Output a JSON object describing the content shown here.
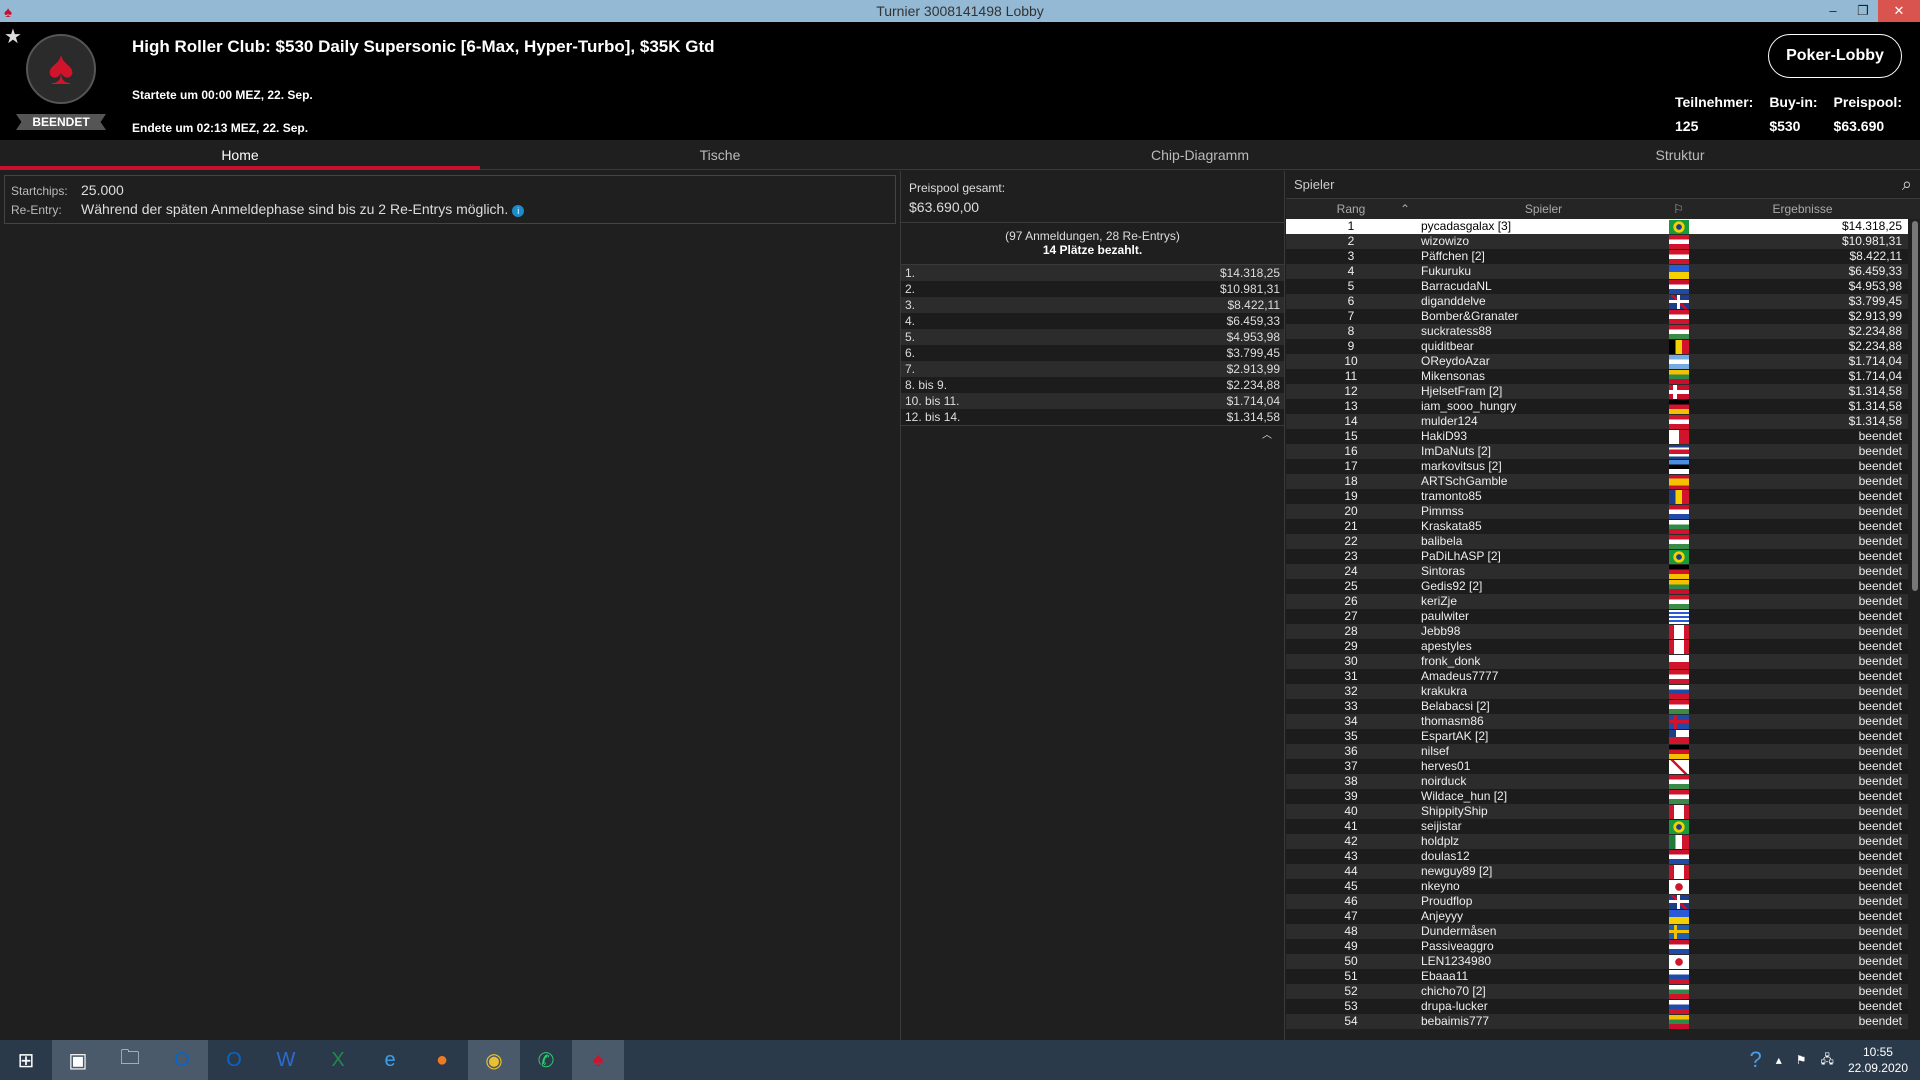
{
  "window": {
    "title": "Turnier 3008141498 Lobby",
    "minimize": "–",
    "restore": "❐",
    "close": "✕"
  },
  "header": {
    "title": "High Roller Club: $530 Daily Supersonic [6-Max, Hyper-Turbo], $35K Gtd",
    "started": "Startete um 00:00 MEZ, 22. Sep.",
    "ended": "Endete um 02:13 MEZ, 22. Sep.",
    "status": "BEENDET",
    "lobby_button": "Poker-Lobby",
    "stats": {
      "participants_label": "Teilnehmer:",
      "participants": "125",
      "buyin_label": "Buy-in:",
      "buyin": "$530",
      "prizepool_label": "Preispool:",
      "prizepool": "$63.690"
    }
  },
  "tabs": [
    {
      "label": "Home",
      "active": true
    },
    {
      "label": "Tische"
    },
    {
      "label": "Chip-Diagramm"
    },
    {
      "label": "Struktur"
    }
  ],
  "home": {
    "startchips_label": "Startchips:",
    "startchips": "25.000",
    "reentry_label": "Re-Entry:",
    "reentry": "Während der späten Anmeldephase sind bis zu 2 Re-Entrys möglich."
  },
  "prizes": {
    "total_label": "Preispool gesamt:",
    "total": "$63.690,00",
    "entries": "(97 Anmeldungen, 28 Re-Entrys)",
    "paid": "14 Plätze bezahlt.",
    "rows": [
      [
        "1.",
        "$14.318,25"
      ],
      [
        "2.",
        "$10.981,31"
      ],
      [
        "3.",
        "$8.422,11"
      ],
      [
        "4.",
        "$6.459,33"
      ],
      [
        "5.",
        "$4.953,98"
      ],
      [
        "6.",
        "$3.799,45"
      ],
      [
        "7.",
        "$2.913,99"
      ],
      [
        "8. bis 9.",
        "$2.234,88"
      ],
      [
        "10. bis 11.",
        "$1.714,04"
      ],
      [
        "12. bis 14.",
        "$1.314,58"
      ]
    ]
  },
  "players": {
    "search_label": "Spieler",
    "col_rank": "Rang",
    "col_player": "Spieler",
    "col_result": "Ergebnisse",
    "rows": [
      [
        "1",
        "pycadasgalax [3]",
        "br",
        "$14.318,25"
      ],
      [
        "2",
        "wizowizo",
        "at",
        "$10.981,31"
      ],
      [
        "3",
        "Päffchen [2]",
        "at",
        "$8.422,11"
      ],
      [
        "4",
        "Fukuruku",
        "ua",
        "$6.459,33"
      ],
      [
        "5",
        "BarracudaNL",
        "nl",
        "$4.953,98"
      ],
      [
        "6",
        "diganddelve",
        "gb",
        "$3.799,45"
      ],
      [
        "7",
        "Bomber&Granater",
        "at",
        "$2.913,99"
      ],
      [
        "8",
        "suckratess88",
        "hu",
        "$2.234,88"
      ],
      [
        "9",
        "quiditbear",
        "be",
        "$2.234,88"
      ],
      [
        "10",
        "OReydoAzar",
        "ar",
        "$1.714,04"
      ],
      [
        "11",
        "Mikensonas",
        "lt",
        "$1.714,04"
      ],
      [
        "12",
        "HjelsetFram [2]",
        "no",
        "$1.314,58"
      ],
      [
        "13",
        "iam_sooo_hungry",
        "de",
        "$1.314,58"
      ],
      [
        "14",
        "mulder124",
        "at",
        "$1.314,58"
      ],
      [
        "15",
        "HakiD93",
        "mt",
        "beendet"
      ],
      [
        "16",
        "ImDaNuts [2]",
        "cr",
        "beendet"
      ],
      [
        "17",
        "markovitsus [2]",
        "ee",
        "beendet"
      ],
      [
        "18",
        "ARTSchGamble",
        "es",
        "beendet"
      ],
      [
        "19",
        "tramonto85",
        "ro",
        "beendet"
      ],
      [
        "20",
        "Pimmss",
        "nl",
        "beendet"
      ],
      [
        "21",
        "Kraskata85",
        "bg",
        "beendet"
      ],
      [
        "22",
        "balibela",
        "hu",
        "beendet"
      ],
      [
        "23",
        "PaDiLhASP [2]",
        "br",
        "beendet"
      ],
      [
        "24",
        "Sintoras",
        "de",
        "beendet"
      ],
      [
        "25",
        "Gedis92 [2]",
        "lt",
        "beendet"
      ],
      [
        "26",
        "keriZje",
        "hu",
        "beendet"
      ],
      [
        "27",
        "paulwiter",
        "uy",
        "beendet"
      ],
      [
        "28",
        "Jebb98",
        "ca",
        "beendet"
      ],
      [
        "29",
        "apestyles",
        "ca",
        "beendet"
      ],
      [
        "30",
        "fronk_donk",
        "pl",
        "beendet"
      ],
      [
        "31",
        "Amadeus7777",
        "at",
        "beendet"
      ],
      [
        "32",
        "krakukra",
        "ru",
        "beendet"
      ],
      [
        "33",
        "Belabacsi [2]",
        "hu",
        "beendet"
      ],
      [
        "34",
        "thomasm86",
        "is",
        "beendet"
      ],
      [
        "35",
        "EspartAK [2]",
        "cl",
        "beendet"
      ],
      [
        "36",
        "nilsef",
        "de",
        "beendet"
      ],
      [
        "37",
        "herves01",
        "je",
        "beendet"
      ],
      [
        "38",
        "noirduck",
        "hu",
        "beendet"
      ],
      [
        "39",
        "Wildace_hun [2]",
        "hu",
        "beendet"
      ],
      [
        "40",
        "ShippityShip",
        "ca",
        "beendet"
      ],
      [
        "41",
        "seijistar",
        "br",
        "beendet"
      ],
      [
        "42",
        "holdplz",
        "mx",
        "beendet"
      ],
      [
        "43",
        "doulas12",
        "nl",
        "beendet"
      ],
      [
        "44",
        "newguy89 [2]",
        "ca",
        "beendet"
      ],
      [
        "45",
        "nkeyno",
        "jp",
        "beendet"
      ],
      [
        "46",
        "Proudflop",
        "gb",
        "beendet"
      ],
      [
        "47",
        "Anjeyyy",
        "ua",
        "beendet"
      ],
      [
        "48",
        "Dundermåsen",
        "se",
        "beendet"
      ],
      [
        "49",
        "Passiveaggro",
        "nl",
        "beendet"
      ],
      [
        "50",
        "LEN1234980",
        "jp",
        "beendet"
      ],
      [
        "51",
        "Ebaaa11",
        "ru",
        "beendet"
      ],
      [
        "52",
        "chicho70 [2]",
        "bg",
        "beendet"
      ],
      [
        "53",
        "drupa-lucker",
        "ru",
        "beendet"
      ],
      [
        "54",
        "bebaimis777",
        "lt",
        "beendet"
      ]
    ]
  },
  "taskbar": {
    "time": "10:55",
    "date": "22.09.2020"
  }
}
